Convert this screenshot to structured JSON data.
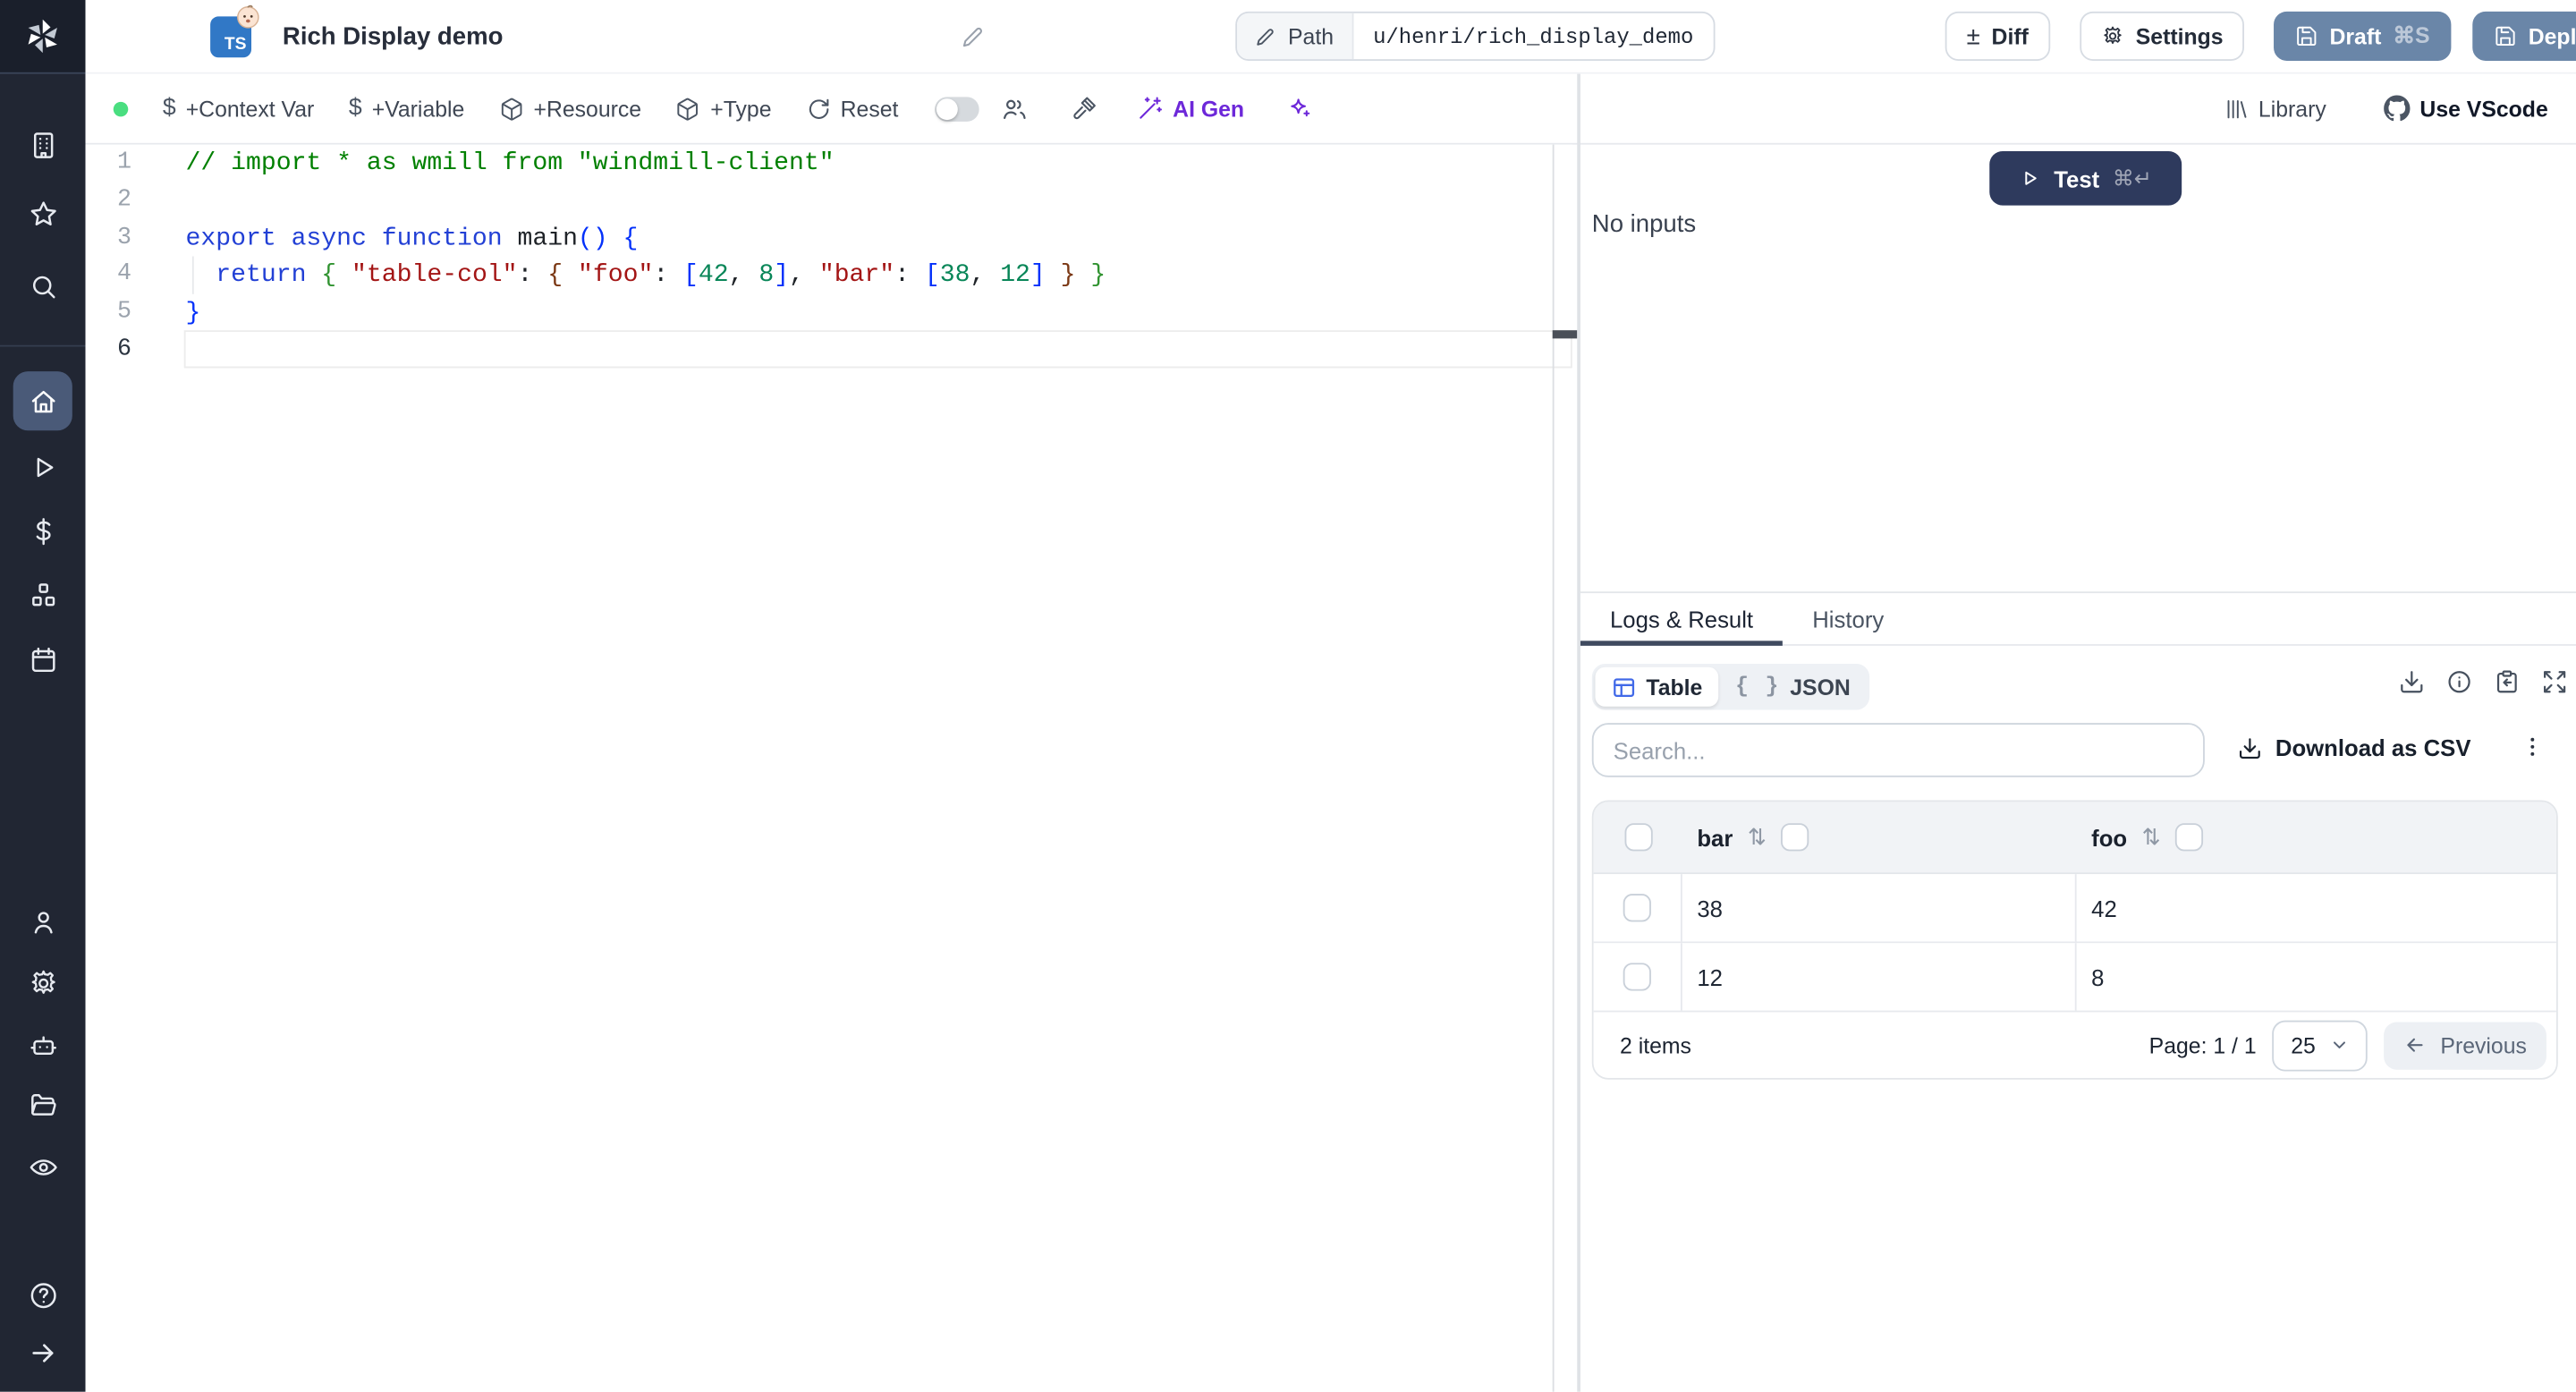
{
  "colors": {
    "sidebar-bg": "#212633",
    "sidebar-logo-bg": "#1a1f2b",
    "sidebar-active-bg": "#4a5a78",
    "slate-button": "#6a86a8",
    "test-button": "#2e3a5d",
    "ai-purple": "#6d28d9",
    "ts-badge": "#3178c6",
    "status-dot": "#4ade80",
    "table-icon-blue": "#4169e8",
    "tab-underline": "#3f4a5f"
  },
  "sidebar": {
    "icons": [
      "windmill-logo",
      "workspace",
      "favorites",
      "search",
      "home",
      "runs",
      "variables",
      "resources",
      "schedules",
      "users",
      "settings",
      "workers",
      "folders",
      "audit-logs",
      "help",
      "expand-sidebar"
    ]
  },
  "topbar": {
    "title": "Rich Display demo",
    "language_badge": "TS",
    "path_label": "Path",
    "path_value": "u/henri/rich_display_demo",
    "diff_label": "Diff",
    "settings_label": "Settings",
    "draft_label": "Draft",
    "draft_shortcut": "⌘S",
    "deploy_label": "Deploy"
  },
  "toolbar": {
    "items": [
      "+Context Var",
      "+Variable",
      "+Resource",
      "+Type",
      "Reset"
    ],
    "ai_gen_label": "AI Gen",
    "library_label": "Library",
    "vscode_label": "Use VScode"
  },
  "editor": {
    "colors": {
      "plain": "#1f2328",
      "comment": "#008000",
      "keyword": "#2240d5",
      "func": "#1f2328",
      "string": "#a31515",
      "number": "#098658",
      "b1": "#0431fa",
      "b2": "#319331",
      "b3": "#7b3814"
    },
    "lines": [
      {
        "n": "1",
        "tokens": [
          [
            "// import * as wmill from \"windmill-client\"",
            "comment"
          ]
        ]
      },
      {
        "n": "2",
        "tokens": []
      },
      {
        "n": "3",
        "tokens": [
          [
            "export async function ",
            "keyword"
          ],
          [
            "main",
            "func"
          ],
          [
            "()",
            "b1"
          ],
          [
            " ",
            "plain"
          ],
          [
            "{",
            "b1"
          ]
        ]
      },
      {
        "n": "4",
        "guide": true,
        "tokens": [
          [
            "  ",
            "plain"
          ],
          [
            "return",
            "keyword"
          ],
          [
            " ",
            "plain"
          ],
          [
            "{",
            "b2"
          ],
          [
            " ",
            "plain"
          ],
          [
            "\"table-col\"",
            "string"
          ],
          [
            ": ",
            "plain"
          ],
          [
            "{",
            "b3"
          ],
          [
            " ",
            "plain"
          ],
          [
            "\"foo\"",
            "string"
          ],
          [
            ": ",
            "plain"
          ],
          [
            "[",
            "b1"
          ],
          [
            "42",
            "number"
          ],
          [
            ", ",
            "plain"
          ],
          [
            "8",
            "number"
          ],
          [
            "]",
            "b1"
          ],
          [
            ", ",
            "plain"
          ],
          [
            "\"bar\"",
            "string"
          ],
          [
            ": ",
            "plain"
          ],
          [
            "[",
            "b1"
          ],
          [
            "38",
            "number"
          ],
          [
            ", ",
            "plain"
          ],
          [
            "12",
            "number"
          ],
          [
            "]",
            "b1"
          ],
          [
            " ",
            "plain"
          ],
          [
            "}",
            "b3"
          ],
          [
            " ",
            "plain"
          ],
          [
            "}",
            "b2"
          ]
        ]
      },
      {
        "n": "5",
        "tokens": [
          [
            "}",
            "b1"
          ]
        ]
      },
      {
        "n": "6",
        "current": true,
        "tokens": []
      }
    ]
  },
  "run_panel": {
    "test_label": "Test",
    "test_shortcut": "⌘↵",
    "no_inputs": "No inputs"
  },
  "result_panel": {
    "tabs": [
      {
        "label": "Logs & Result",
        "active": true
      },
      {
        "label": "History",
        "active": false
      }
    ],
    "view_toggle": {
      "table_label": "Table",
      "json_label": "JSON",
      "braces_glyph": "{ }"
    },
    "search_placeholder": "Search...",
    "download_csv_label": "Download as CSV",
    "table": {
      "columns": [
        "bar",
        "foo"
      ],
      "sort_glyph": "⇅",
      "rows": [
        [
          "38",
          "42"
        ],
        [
          "12",
          "8"
        ]
      ],
      "items_label": "2 items",
      "page_label": "Page: 1 / 1",
      "page_size": "25",
      "previous_label": "Previous"
    }
  }
}
